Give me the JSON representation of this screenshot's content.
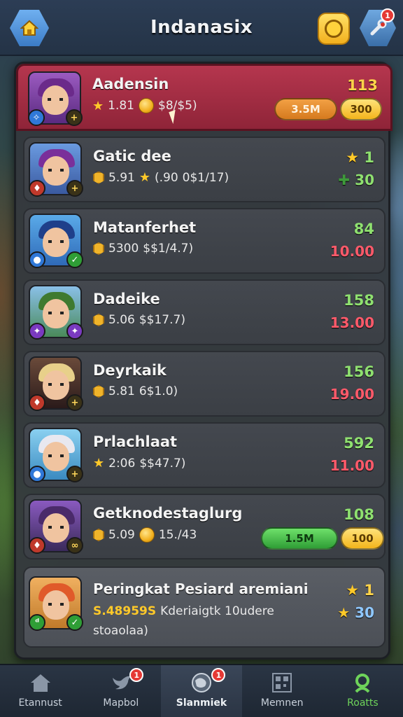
{
  "header": {
    "title": "Indanasix"
  },
  "rows": [
    {
      "name": "Aadensin",
      "stat1": "1.81",
      "stat2": "$8/$5)",
      "score_top": "113",
      "score_top_color": "#ffd34a",
      "pill1": "3.5M",
      "pill2": "300",
      "hair": "#6b2a8a",
      "bg": "#7c3a9e",
      "badge_left": "#2f78d8"
    },
    {
      "name": "Gatic dee",
      "stat1": "5.91",
      "stat2": "(.90",
      "stat3": "0$1/17)",
      "score_top": "1",
      "score_top_color": "#8fe070",
      "score_bottom": "30",
      "score_bottom_color": "#8fe070",
      "hair": "#7a2f9a",
      "bg": "#4a7ad0",
      "badge_left": "#c0392b"
    },
    {
      "name": "Matanferhet",
      "stat1": "5300",
      "stat2": "$$1/4.7)",
      "score_top": "84",
      "score_top_color": "#8fe070",
      "score_bottom": "10.00",
      "score_bottom_color": "#ff5a6a",
      "hair": "#1f3f8a",
      "bg": "#3d8ad8",
      "badge_left": "#2f78d8"
    },
    {
      "name": "Dadeike",
      "stat1": "5.06",
      "stat2": "$$17.7)",
      "score_top": "158",
      "score_top_color": "#8fe070",
      "score_bottom": "13.00",
      "score_bottom_color": "#ff5a6a",
      "hair": "#3f7a2f",
      "bg": "#6aa0e0",
      "badge_left": "#7a3ac0"
    },
    {
      "name": "Deyrkaik",
      "stat1": "5.81",
      "stat2": "6$1.0)",
      "score_top": "156",
      "score_top_color": "#8fe070",
      "score_bottom": "19.00",
      "score_bottom_color": "#ff5a6a",
      "hair": "#e8d08a",
      "bg": "#5a3a2a",
      "badge_left": "#c0392b"
    },
    {
      "name": "Prlachlaat",
      "stat1": "2:06",
      "stat2": "$$47.7)",
      "score_top": "592",
      "score_top_color": "#8fe070",
      "score_bottom": "11.00",
      "score_bottom_color": "#ff5a6a",
      "hair": "#e8e8f0",
      "bg": "#4aa0d8",
      "badge_left": "#2f78d8"
    },
    {
      "name": "Getknodestaglurg",
      "stat1": "5.09",
      "stat2": "15./43",
      "score_top": "108",
      "score_top_color": "#8fe070",
      "pill1": "1.5M",
      "pill2": "100",
      "hair": "#4a2a6a",
      "bg": "#6a3a9a",
      "badge_left": "#c0392b"
    },
    {
      "name": "Peringkat Pesiard aremiani",
      "stat1": "S.48959S",
      "stat2": "Kderiaigtk 10udere",
      "stat3": "stoaolaa)",
      "score_top": "1",
      "score_top_color": "#ffd34a",
      "score_bottom": "30",
      "score_bottom_color": "#8fc8ff",
      "hair": "#e05a2a",
      "bg": "#d89a3a",
      "badge_left": "#2f9e36"
    }
  ],
  "nav": {
    "items": [
      {
        "label": "Etannust",
        "badge": ""
      },
      {
        "label": "Mapbol",
        "badge": "1"
      },
      {
        "label": "Slanmiek",
        "badge": "1"
      },
      {
        "label": "Memnen",
        "badge": ""
      },
      {
        "label": "Roatts",
        "badge": ""
      }
    ]
  },
  "settings_badge": "1",
  "colors": {
    "accent_red": "#b5364e",
    "gold": "#ffd34a",
    "green": "#8fe070",
    "red_value": "#ff5a6a"
  }
}
